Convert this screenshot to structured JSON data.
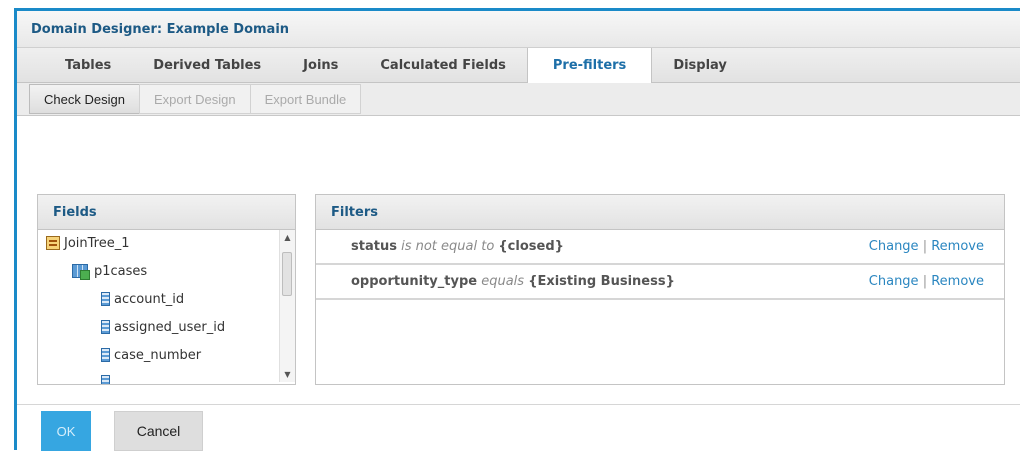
{
  "window": {
    "title": "Domain Designer: Example Domain"
  },
  "tabs": [
    {
      "label": "Tables",
      "active": false
    },
    {
      "label": "Derived Tables",
      "active": false
    },
    {
      "label": "Joins",
      "active": false
    },
    {
      "label": "Calculated Fields",
      "active": false
    },
    {
      "label": "Pre-filters",
      "active": true
    },
    {
      "label": "Display",
      "active": false
    }
  ],
  "toolbar": {
    "check_design": "Check Design",
    "export_design": "Export Design",
    "export_bundle": "Export Bundle"
  },
  "fields_panel": {
    "title": "Fields",
    "tree": [
      {
        "label": "JoinTree_1",
        "icon": "join-tree-icon"
      },
      {
        "label": "p1cases",
        "icon": "table-icon"
      },
      {
        "label": "account_id",
        "icon": "field-icon"
      },
      {
        "label": "assigned_user_id",
        "icon": "field-icon"
      },
      {
        "label": "case_number",
        "icon": "field-icon"
      }
    ]
  },
  "filters_panel": {
    "title": "Filters",
    "filters": [
      {
        "field": "status",
        "operator": "is not equal to",
        "value": "{closed}",
        "change": "Change",
        "remove": "Remove"
      },
      {
        "field": "opportunity_type",
        "operator": "equals",
        "value": "{Existing Business}",
        "change": "Change",
        "remove": "Remove"
      }
    ]
  },
  "footer": {
    "ok": "OK",
    "cancel": "Cancel"
  },
  "colors": {
    "accent": "#1a8ac8",
    "ok_button": "#36a6e1",
    "link": "#2a86c0"
  }
}
